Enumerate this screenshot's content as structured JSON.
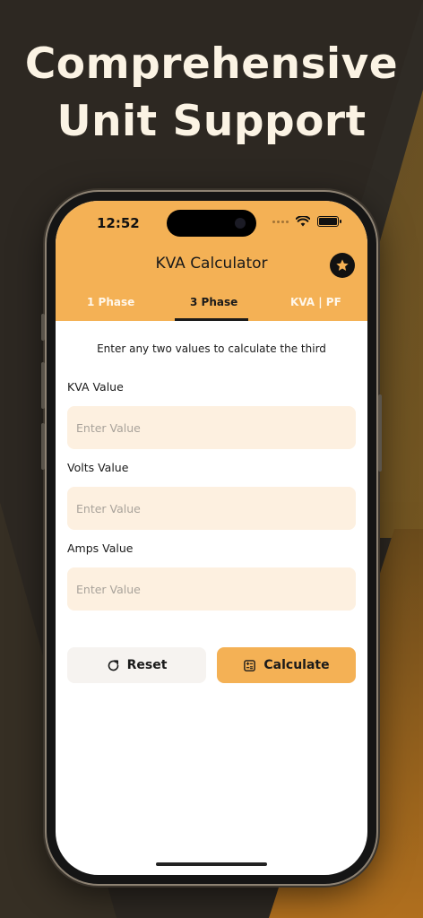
{
  "headline": {
    "line1": "Comprehensive",
    "line2": "Unit Support"
  },
  "status_bar": {
    "time": "12:52",
    "icons": [
      "cellular-dots-icon",
      "wifi-icon",
      "battery-icon"
    ]
  },
  "header": {
    "title": "KVA Calculator",
    "favorite_icon": "star-icon"
  },
  "tabs": [
    {
      "label": "1 Phase",
      "active": false
    },
    {
      "label": "3 Phase",
      "active": true
    },
    {
      "label": "KVA | PF",
      "active": false
    }
  ],
  "form": {
    "hint": "Enter any two values to calculate the third",
    "fields": [
      {
        "label": "KVA Value",
        "placeholder": "Enter Value",
        "value": ""
      },
      {
        "label": "Volts Value",
        "placeholder": "Enter Value",
        "value": ""
      },
      {
        "label": "Amps Value",
        "placeholder": "Enter Value",
        "value": ""
      }
    ]
  },
  "actions": {
    "reset": {
      "label": "Reset",
      "icon": "refresh-icon"
    },
    "calculate": {
      "label": "Calculate",
      "icon": "calculator-icon"
    }
  },
  "colors": {
    "accent": "#f4b155",
    "field_bg": "#fdf0e0",
    "background": "#2b2620",
    "headline": "#fbf3e4"
  }
}
